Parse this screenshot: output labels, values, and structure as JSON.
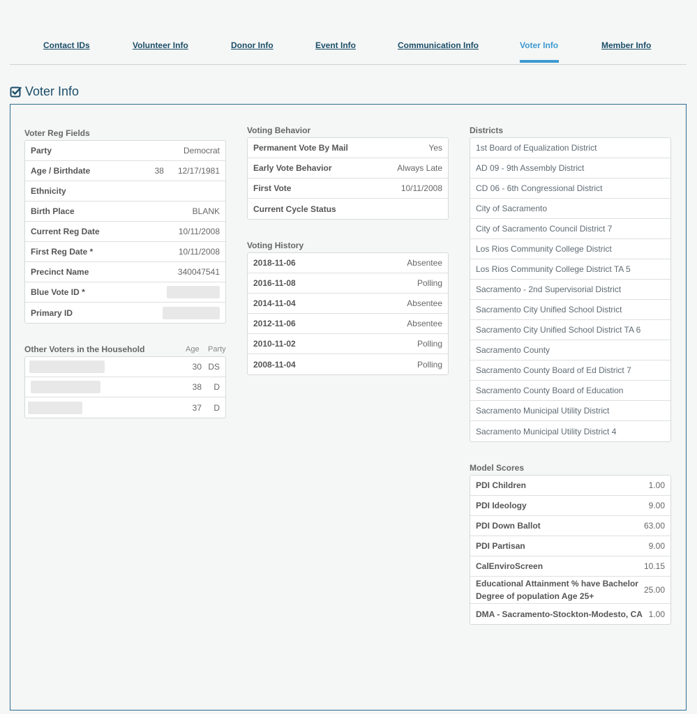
{
  "tabs": [
    {
      "label": "Contact IDs"
    },
    {
      "label": "Volunteer Info"
    },
    {
      "label": "Donor Info"
    },
    {
      "label": "Event Info"
    },
    {
      "label": "Communication Info"
    },
    {
      "label": "Voter Info"
    },
    {
      "label": "Member Info"
    }
  ],
  "active_tab": "Voter Info",
  "section": {
    "title": "Voter Info",
    "checked": true
  },
  "voter_reg": {
    "title": "Voter Reg Fields",
    "party_label": "Party",
    "party_value": "Democrat",
    "age_label": "Age / Birthdate",
    "age_value": "38",
    "birthdate_value": "12/17/1981",
    "ethnicity_label": "Ethnicity",
    "birthplace_label": "Birth Place",
    "birthplace_value": "BLANK",
    "current_reg_label": "Current Reg Date",
    "current_reg_value": "10/11/2008",
    "first_reg_label": "First Reg Date *",
    "first_reg_value": "10/11/2008",
    "precinct_label": "Precinct Name",
    "precinct_value": "340047541",
    "blue_vote_label": "Blue Vote ID *",
    "primary_id_label": "Primary ID"
  },
  "household": {
    "title": "Other Voters in the Household",
    "age_header": "Age",
    "party_header": "Party",
    "members": [
      {
        "age": "30",
        "party": "DS"
      },
      {
        "age": "38",
        "party": "D"
      },
      {
        "age": "37",
        "party": "D"
      }
    ]
  },
  "voting_behavior": {
    "title": "Voting Behavior",
    "rows": [
      {
        "label": "Permanent Vote By Mail",
        "value": "Yes"
      },
      {
        "label": "Early Vote Behavior",
        "value": "Always Late"
      },
      {
        "label": "First Vote",
        "value": "10/11/2008"
      },
      {
        "label": "Current Cycle Status",
        "value": ""
      }
    ]
  },
  "voting_history": {
    "title": "Voting History",
    "rows": [
      {
        "date": "2018-11-06",
        "method": "Absentee"
      },
      {
        "date": "2016-11-08",
        "method": "Polling"
      },
      {
        "date": "2014-11-04",
        "method": "Absentee"
      },
      {
        "date": "2012-11-06",
        "method": "Absentee"
      },
      {
        "date": "2010-11-02",
        "method": "Polling"
      },
      {
        "date": "2008-11-04",
        "method": "Polling"
      }
    ]
  },
  "districts": {
    "title": "Districts",
    "items": [
      "1st Board of Equalization District",
      "AD 09 - 9th Assembly District",
      "CD 06 - 6th Congressional District",
      "City of Sacramento",
      "City of Sacramento Council District 7",
      "Los Rios Community College District",
      "Los Rios Community College District TA 5",
      "Sacramento - 2nd Supervisorial District",
      "Sacramento City Unified School District",
      "Sacramento City Unified School District TA 6",
      "Sacramento County",
      "Sacramento County Board of Ed District 7",
      "Sacramento County Board of Education",
      "Sacramento Municipal Utility District",
      "Sacramento Municipal Utility District 4"
    ]
  },
  "model_scores": {
    "title": "Model Scores",
    "rows": [
      {
        "label": "PDI Children",
        "value": "1.00"
      },
      {
        "label": "PDI Ideology",
        "value": "9.00"
      },
      {
        "label": "PDI Down Ballot",
        "value": "63.00"
      },
      {
        "label": "PDI Partisan",
        "value": "9.00"
      },
      {
        "label": "CalEnviroScreen",
        "value": "10.15"
      },
      {
        "label": "Educational Attainment % have Bachelor Degree of population Age 25+",
        "value": "25.00"
      },
      {
        "label": "DMA - Sacramento-Stockton-Modesto, CA",
        "value": "1.00"
      }
    ]
  },
  "colors": {
    "accent": "#3c9ad1",
    "heading": "#1b4e68",
    "frame_border": "#2d6e8e"
  }
}
